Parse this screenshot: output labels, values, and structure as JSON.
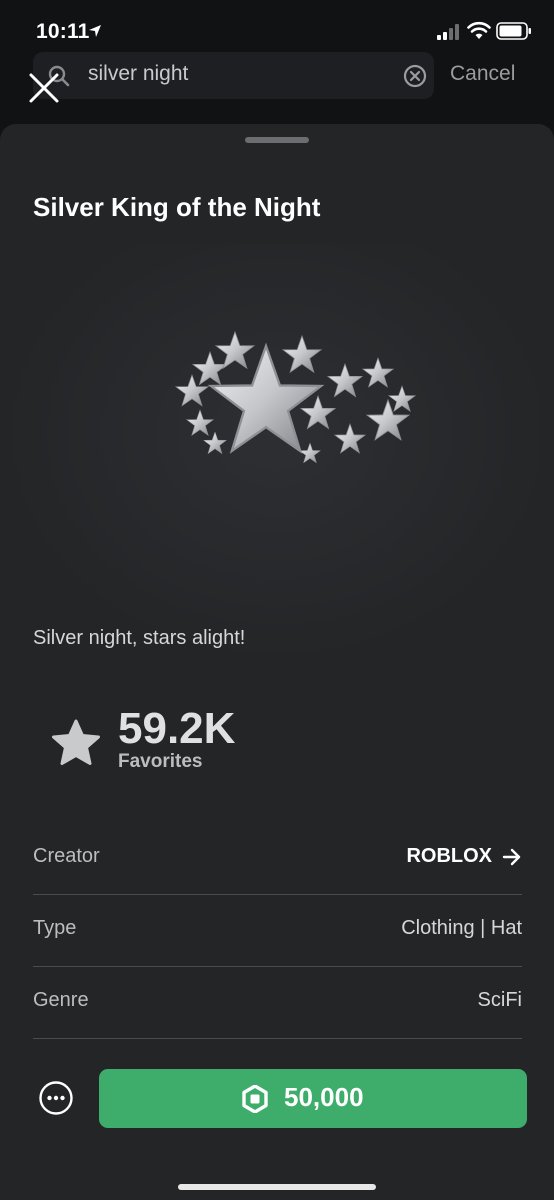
{
  "status_bar": {
    "time": "10:11"
  },
  "search": {
    "query": "silver night",
    "cancel_label": "Cancel"
  },
  "item": {
    "title": "Silver King of the Night",
    "description": "Silver night, stars alight!",
    "favorites_count": "59.2K",
    "favorites_label": "Favorites"
  },
  "details": [
    {
      "label": "Creator",
      "value": "ROBLOX"
    },
    {
      "label": "Type",
      "value": "Clothing | Hat"
    },
    {
      "label": "Genre",
      "value": "SciFi"
    }
  ],
  "purchase": {
    "price": "50,000"
  },
  "colors": {
    "buy_button": "#3ead6b",
    "sheet_bg": "#232527",
    "page_bg": "#111214"
  }
}
